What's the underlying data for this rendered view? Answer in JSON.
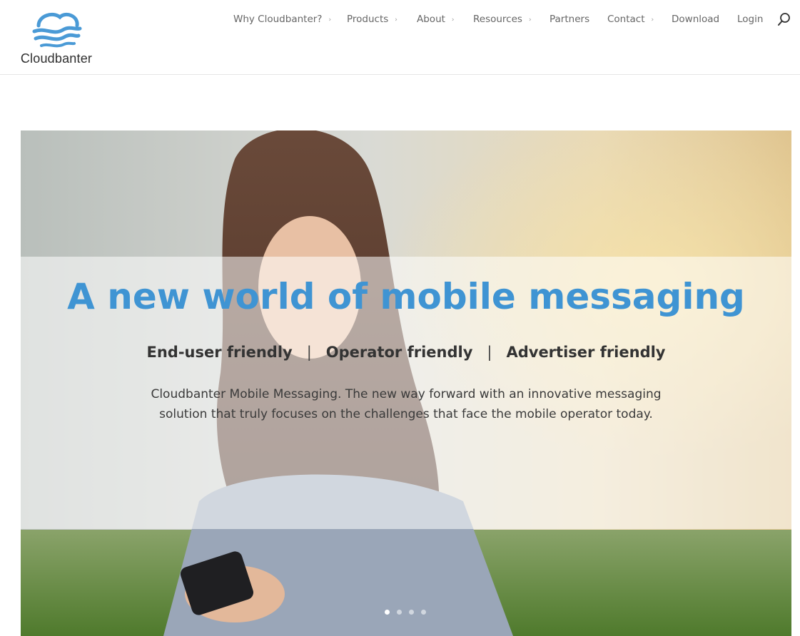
{
  "brand": {
    "name": "Cloudbanter",
    "logo_icon": "cloud-logo-icon",
    "accent_color": "#3f94d3"
  },
  "nav": {
    "items": [
      {
        "label": "Why Cloudbanter?",
        "has_dropdown": true
      },
      {
        "label": "Products",
        "has_dropdown": true
      },
      {
        "label": "About",
        "has_dropdown": true
      },
      {
        "label": "Resources",
        "has_dropdown": true
      },
      {
        "label": "Partners",
        "has_dropdown": false
      },
      {
        "label": "Contact",
        "has_dropdown": true
      },
      {
        "label": "Download",
        "has_dropdown": false
      },
      {
        "label": "Login",
        "has_dropdown": false
      }
    ],
    "caret_glyph": "›",
    "search_icon": "search-icon"
  },
  "hero": {
    "title": "A new world of mobile messaging",
    "taglines": [
      "End-user friendly",
      "Operator friendly",
      "Advertiser friendly"
    ],
    "separator": "|",
    "description": "Cloudbanter Mobile Messaging. The new way forward with an innovative messaging solution that truly focuses on the challenges that face the mobile operator today.",
    "slides_total": 4,
    "active_slide": 1
  }
}
